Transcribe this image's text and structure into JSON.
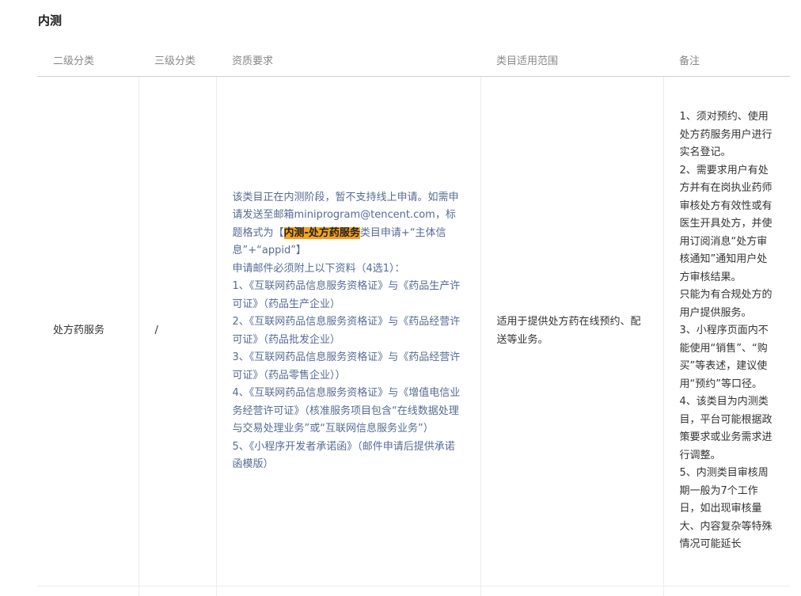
{
  "section": {
    "title": "内测"
  },
  "table": {
    "headers": [
      "二级分类",
      "三级分类",
      "资质要求",
      "类目适用范围",
      "备注"
    ],
    "row": {
      "level2": "处方药服务",
      "level3": "/",
      "requirements": {
        "intro_before": "该类目正在内测阶段，暂不支持线上申请。如需申请发送至邮箱miniprogram@tencent.com，标题格式为【",
        "highlight": "内测-处方药服务",
        "intro_after": "类目申请+“主体信息”+“appid”】",
        "attach_note": "申请邮件必须附上以下资料（4选1）：",
        "items": [
          "1、《互联网药品信息服务资格证》与《药品生产许可证》（药品生产企业）",
          "2、《互联网药品信息服务资格证》与《药品经营许可证》（药品批发企业）",
          "3、《互联网药品信息服务资格证》与《药品经营许可证》（药品零售企业））",
          "4、《互联网药品信息服务资格证》与《增值电信业务经营许可证》（核准服务项目包含“在线数据处理与交易处理业务”或“互联网信息服务业务”）",
          "5、《小程序开发者承诺函》（邮件申请后提供承诺函模版）"
        ]
      },
      "scope": "适用于提供处方药在线预约、配送等业务。",
      "notes": [
        "1、须对预约、使用处方药服务用户进行实名登记。",
        "2、需要求用户有处方并有在岗执业药师审核处方有效性或有医生开具处方，并使用订阅消息“处方审核通知”通知用户处方审核结果。",
        "只能为有合规处方的用户提供服务。",
        "3、小程序页面内不能使用“销售”、“购买”等表述，建议使用“预约”等口径。",
        "4、该类目为内测类目，平台可能根据政策要求或业务需求进行调整。",
        "5、内测类目审核周期一般为7个工作日，如出现审核量大、内容复杂等特殊情况可能延长"
      ]
    }
  }
}
